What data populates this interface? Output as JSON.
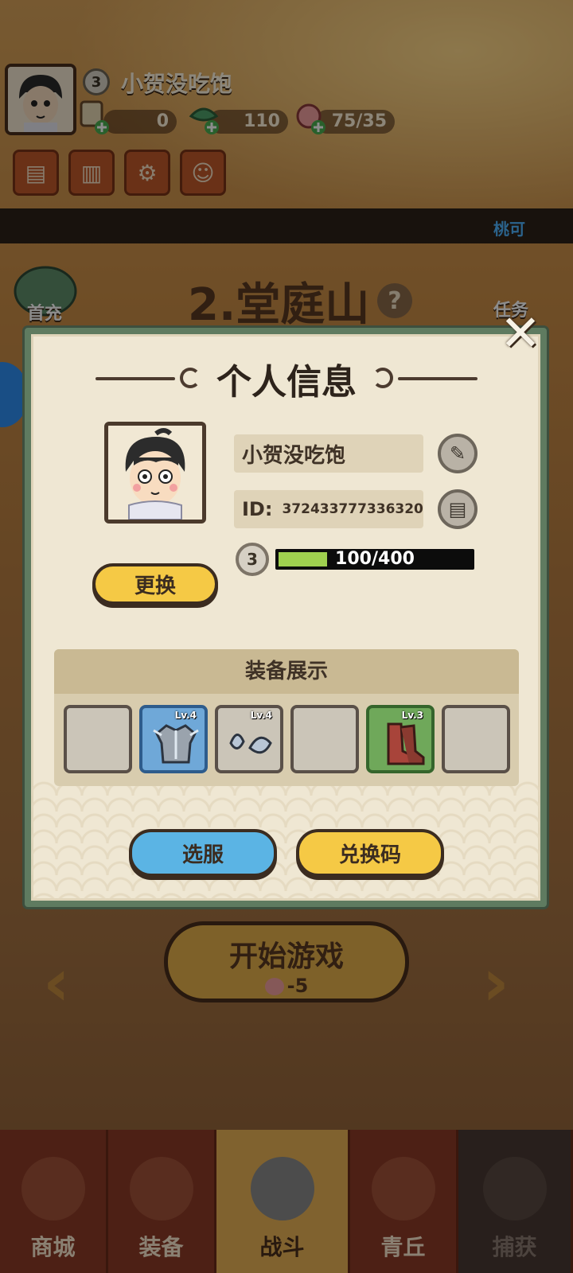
{
  "background": {
    "player_name": "小贺没吃饱",
    "player_level": "3",
    "resources": [
      {
        "icon": "scroll-coin-icon",
        "value": "0"
      },
      {
        "icon": "jade-icon",
        "value": "110"
      },
      {
        "icon": "peach-icon",
        "value": "75/35"
      }
    ],
    "strip_text": "桃可",
    "stage_title": "2.堂庭山",
    "stage_help": "?",
    "side_left_label": "首充",
    "side_right_label": "任务",
    "start_button": {
      "label": "开始游戏",
      "cost": "-5"
    },
    "bottom_tabs": [
      "商城",
      "装备",
      "战斗",
      "青丘",
      "捕获"
    ]
  },
  "dialog": {
    "title": "个人信息",
    "name": "小贺没吃饱",
    "id_label": "ID:",
    "id_value": "372433777336320",
    "level": "3",
    "xp_text": "100/400",
    "xp_progress": 0.25,
    "change_avatar_label": "更换",
    "equipment_header": "装备展示",
    "equipment_slots": [
      {
        "empty": true
      },
      {
        "empty": false,
        "level": "Lv.4",
        "rarity": "blue",
        "item": "armor"
      },
      {
        "empty": false,
        "level": "Lv.4",
        "rarity": "gray",
        "item": "bracer"
      },
      {
        "empty": true
      },
      {
        "empty": false,
        "level": "Lv.3",
        "rarity": "green",
        "item": "boots"
      },
      {
        "empty": true
      }
    ],
    "select_server_label": "选服",
    "redeem_code_label": "兑换码",
    "close": "✕"
  },
  "colors": {
    "dialog_border": "#5f7b60",
    "xp_fill": "#9fd04f",
    "yellow_button": "#f5c945",
    "blue_button": "#5bb4e4"
  }
}
